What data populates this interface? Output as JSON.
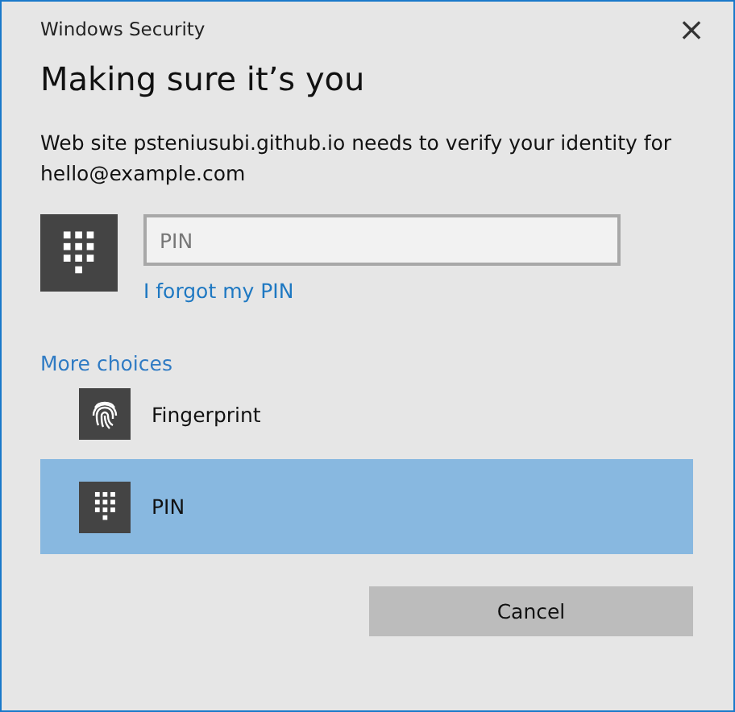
{
  "window": {
    "title": "Windows Security",
    "close": "×"
  },
  "heading": "Making sure it’s you",
  "message": "Web site psteniusubi.github.io needs to verify your identity for hello@example.com",
  "pin_field": {
    "placeholder": "PIN"
  },
  "forgot_link": "I forgot my PIN",
  "more_choices": "More choices",
  "choices": [
    {
      "kind": "fingerprint",
      "label": "Fingerprint",
      "selected": false
    },
    {
      "kind": "pin",
      "label": "PIN",
      "selected": true
    }
  ],
  "buttons": [
    "Cancel"
  ]
}
